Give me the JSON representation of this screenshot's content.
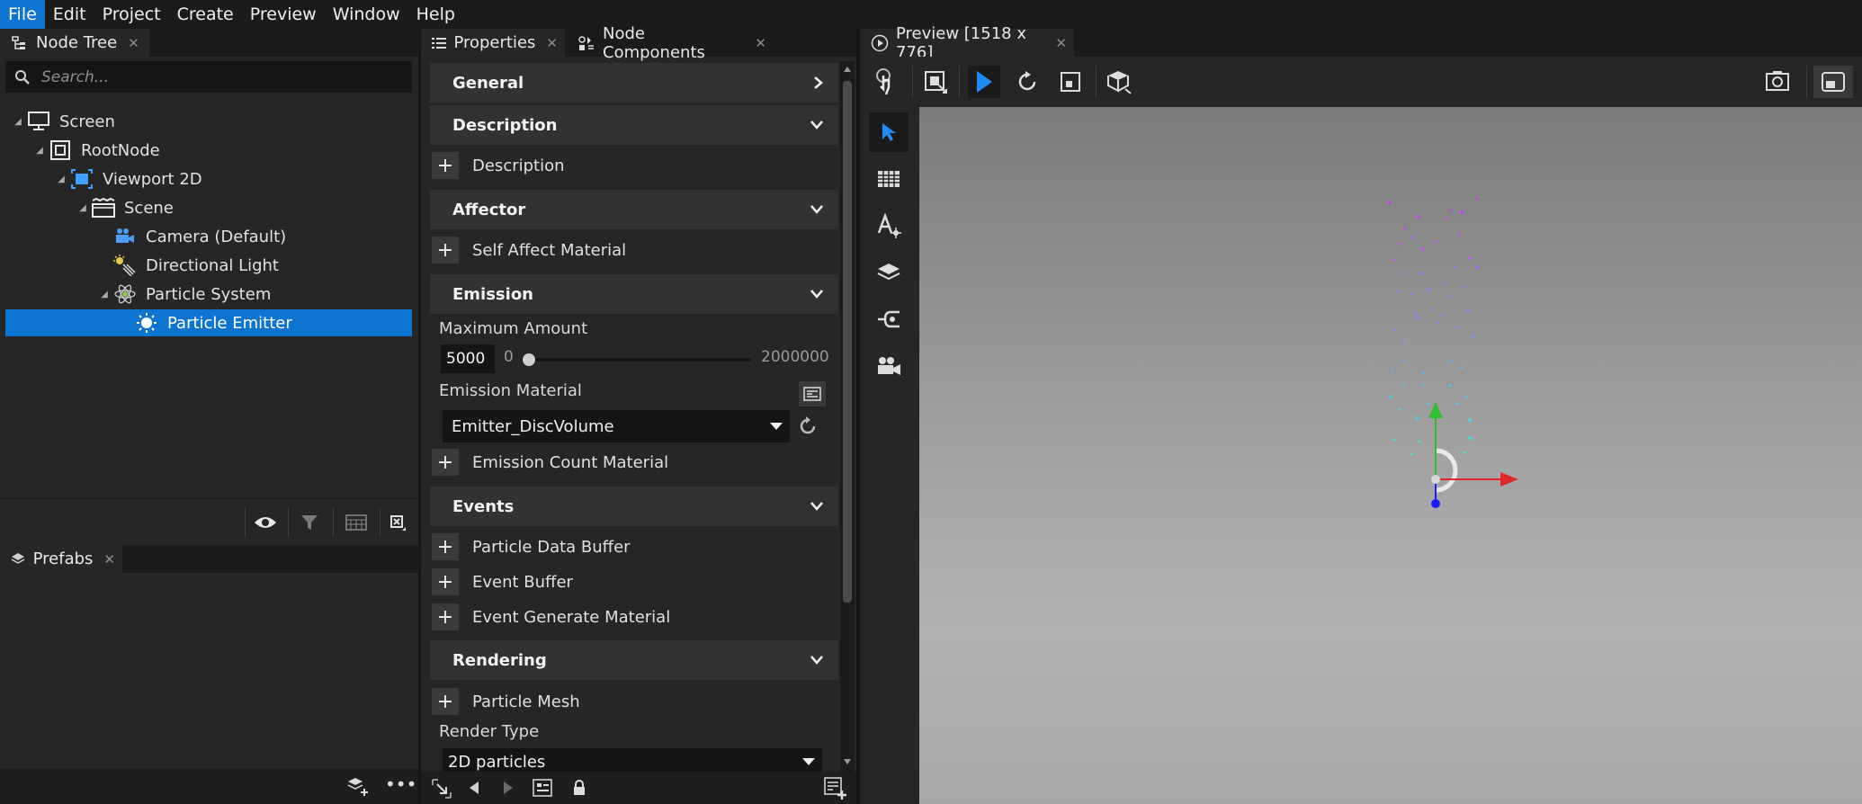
{
  "menu": [
    "File",
    "Edit",
    "Project",
    "Create",
    "Preview",
    "Window",
    "Help"
  ],
  "node_tree": {
    "tab_label": "Node Tree",
    "search_placeholder": "Search...",
    "nodes": [
      {
        "label": "Screen",
        "icon": "monitor-icon"
      },
      {
        "label": "RootNode",
        "icon": "root-node-icon"
      },
      {
        "label": "Viewport 2D",
        "icon": "viewport-icon"
      },
      {
        "label": "Scene",
        "icon": "scene-icon"
      },
      {
        "label": "Camera (Default)",
        "icon": "camera-icon"
      },
      {
        "label": "Directional Light",
        "icon": "light-icon"
      },
      {
        "label": "Particle System",
        "icon": "particle-system-icon"
      },
      {
        "label": "Particle Emitter",
        "icon": "particle-emitter-icon",
        "selected": true
      }
    ]
  },
  "prefabs": {
    "tab_label": "Prefabs"
  },
  "properties": {
    "tab_label": "Properties",
    "components_tab_label": "Node Components",
    "sections": {
      "general": "General",
      "description": "Description",
      "affector": "Affector",
      "emission": "Emission",
      "events": "Events",
      "rendering": "Rendering"
    },
    "add_items": {
      "description": "Description",
      "self_affect_material": "Self Affect Material",
      "emission_count_material": "Emission Count Material",
      "particle_data_buffer": "Particle Data Buffer",
      "event_buffer": "Event Buffer",
      "event_generate_material": "Event Generate Material",
      "particle_mesh": "Particle Mesh"
    },
    "maximum_amount": {
      "label": "Maximum Amount",
      "value": "5000",
      "min": "0",
      "max": "2000000",
      "slider_fraction": 0.0025
    },
    "emission_material": {
      "label": "Emission Material",
      "value": "Emitter_DiscVolume"
    },
    "render_type": {
      "label": "Render Type",
      "value": "2D particles"
    }
  },
  "preview": {
    "tab_label": "Preview [1518 x 776]"
  },
  "colors": {
    "accent": "#0e74d2",
    "panel": "#262626",
    "header": "#323232"
  }
}
